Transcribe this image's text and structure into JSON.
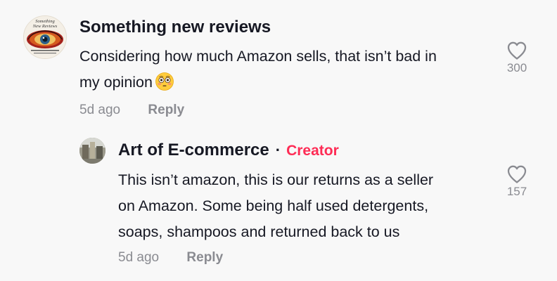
{
  "comments": [
    {
      "author": "Something new reviews",
      "avatar_text": [
        "Something",
        "New Reviews"
      ],
      "text_lines": [
        "Considering how much Amazon sells, that isn’t bad in",
        "my opinion"
      ],
      "emoji": "flushed-face",
      "date": "5d ago",
      "reply_label": "Reply",
      "likes": "300"
    },
    {
      "author": "Art of E-commerce",
      "separator": "·",
      "badge": "Creator",
      "text_lines": [
        "This isn’t amazon, this is our returns as a seller",
        "on Amazon. Some being half used detergents,",
        "soaps, shampoos and returned back to us"
      ],
      "date": "5d ago",
      "reply_label": "Reply",
      "likes": "157"
    }
  ],
  "colors": {
    "creator_badge": "#fe2c55",
    "meta_text": "#8a8b91",
    "primary_text": "#161823"
  },
  "icons": {
    "like": "heart-outline-icon"
  }
}
